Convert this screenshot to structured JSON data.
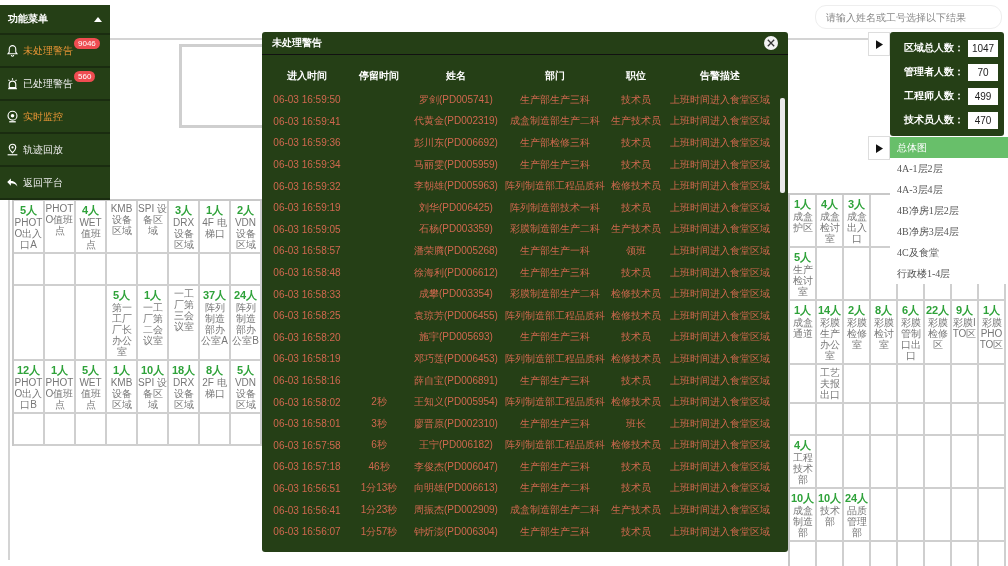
{
  "search": {
    "placeholder": "请输入姓名或工号选择以下结果"
  },
  "menu": {
    "title": "功能菜单",
    "expanded": true,
    "items": [
      {
        "label": "未处理警告",
        "highlighted": true,
        "badge": "9046"
      },
      {
        "label": "已处理警告",
        "highlighted": false,
        "badge": "560"
      },
      {
        "label": "实时监控",
        "highlighted": true
      },
      {
        "label": "轨迹回放",
        "highlighted": false
      },
      {
        "label": "返回平台",
        "highlighted": false
      }
    ]
  },
  "stats": [
    {
      "label": "区域总人数：",
      "value": "1047"
    },
    {
      "label": "管理者人数：",
      "value": "70"
    },
    {
      "label": "工程师人数：",
      "value": "499"
    },
    {
      "label": "技术员人数：",
      "value": "470"
    }
  ],
  "floors": [
    {
      "label": "总体图",
      "selected": true
    },
    {
      "label": "4A-1层2层",
      "selected": false
    },
    {
      "label": "4A-3层4层",
      "selected": false
    },
    {
      "label": "4B净房1层2层",
      "selected": false
    },
    {
      "label": "4B净房3层4层",
      "selected": false
    },
    {
      "label": "4C及食堂",
      "selected": false
    },
    {
      "label": "行政楼1-4层",
      "selected": false
    }
  ],
  "plan": {
    "left_rooms": [
      {
        "kind": "rooms",
        "cells": [
          {
            "kind": "room",
            "count": "5人",
            "label": "PHOTO出入口A"
          },
          {
            "kind": "room",
            "label": "PHOTO值班点"
          },
          {
            "kind": "room",
            "count": "4人",
            "label": "WET 值班点"
          },
          {
            "kind": "room",
            "label": "KMB 设备区域"
          },
          {
            "kind": "room",
            "label": "SPI 设备区域"
          },
          {
            "kind": "room",
            "count": "3人",
            "label": "DRX 设备区域"
          },
          {
            "kind": "room",
            "count": "1人",
            "label": "4F 电梯口"
          },
          {
            "kind": "room",
            "count": "2人",
            "label": "VDN 设备区域"
          }
        ]
      },
      {
        "kind": "blank"
      },
      {
        "kind": "rooms",
        "cells": [
          {
            "kind": "empty"
          },
          {
            "kind": "empty"
          },
          {
            "kind": "empty"
          },
          {
            "kind": "room",
            "count": "5人",
            "label": "第一工厂厂长办公室"
          },
          {
            "kind": "room",
            "count": "1人",
            "label": "一工厂第二会议室"
          },
          {
            "kind": "room",
            "label": "一工厂第三会议室"
          },
          {
            "kind": "room",
            "count": "37人",
            "label": "阵列制造部办公室A"
          },
          {
            "kind": "room",
            "count": "24人",
            "label": "阵列制造部办公室B"
          }
        ]
      },
      {
        "kind": "rooms",
        "cells": [
          {
            "kind": "room",
            "count": "12人",
            "label": "PHOTO出入口B"
          },
          {
            "kind": "room",
            "count": "1人",
            "label": "PHOTO值班点"
          },
          {
            "kind": "room",
            "count": "5人",
            "label": "WET 值班点"
          },
          {
            "kind": "room",
            "count": "1人",
            "label": "KMB 设备区域"
          },
          {
            "kind": "room",
            "count": "10人",
            "label": "SPI 设备区域"
          },
          {
            "kind": "room",
            "count": "18人",
            "label": "DRX 设备区域"
          },
          {
            "kind": "room",
            "count": "8人",
            "label": "2F 电梯口"
          },
          {
            "kind": "room",
            "count": "5人",
            "label": "VDN 设备区域"
          }
        ]
      },
      {
        "kind": "blank"
      }
    ],
    "right_rooms": [
      {
        "kind": "rooms",
        "cells": [
          {
            "kind": "room",
            "count": "1人",
            "label": "成盒护区"
          },
          {
            "kind": "room",
            "count": "4人",
            "label": "成盒检讨室"
          },
          {
            "kind": "room",
            "count": "3人",
            "label": "成盒出入口"
          }
        ]
      },
      {
        "kind": "rooms",
        "cells": [
          {
            "kind": "room",
            "count": "5人",
            "label": "生产检讨室"
          }
        ]
      },
      {
        "kind": "rooms",
        "cells": [
          {
            "kind": "room",
            "count": "1人",
            "label": "成盒通道"
          },
          {
            "kind": "room",
            "count": "14人",
            "label": "彩膜生产办公室"
          },
          {
            "kind": "room",
            "count": "2人",
            "label": "彩膜检修室"
          },
          {
            "kind": "room",
            "count": "8人",
            "label": "彩膜检讨室"
          },
          {
            "kind": "room",
            "count": "6人",
            "label": "彩膜管制口出口"
          },
          {
            "kind": "room",
            "count": "22人",
            "label": "彩膜检修区"
          },
          {
            "kind": "room",
            "count": "9人",
            "label": "彩膜ITO区"
          },
          {
            "kind": "room",
            "count": "1人",
            "label": "彩膜PHOTO区"
          }
        ]
      },
      {
        "kind": "rooms",
        "cells": [
          {
            "kind": "empty"
          },
          {
            "kind": "room",
            "label": "工艺夫报出口"
          }
        ]
      },
      {
        "kind": "blank"
      },
      {
        "kind": "rooms",
        "cells": [
          {
            "kind": "room",
            "count": "4人",
            "label": "工程技术部"
          }
        ]
      },
      {
        "kind": "rooms",
        "cells": [
          {
            "kind": "room",
            "count": "10人",
            "label": "成盒制造部"
          },
          {
            "kind": "room",
            "count": "10人",
            "label": "技术部"
          },
          {
            "kind": "room",
            "count": "24人",
            "label": "品质管理部"
          }
        ]
      },
      {
        "kind": "blank"
      }
    ]
  },
  "dialog": {
    "title": "未处理警告",
    "columns": [
      "进入时间",
      "停留时间",
      "姓名",
      "部门",
      "职位",
      "告警描述"
    ],
    "rows": [
      {
        "time": "06-03 16:59:50",
        "name": "罗剑(PD005741)",
        "department": "生产部生产三科",
        "position": "技术员",
        "description": "上班时间进入食堂区域"
      },
      {
        "time": "06-03 16:59:41",
        "name": "代黄金(PD002319)",
        "department": "成盒制造部生产二科",
        "position": "生产技术员",
        "description": "上班时间进入食堂区域"
      },
      {
        "time": "06-03 16:59:36",
        "name": "彭川东(PD006692)",
        "department": "生产部检修三科",
        "position": "技术员",
        "description": "上班时间进入食堂区域"
      },
      {
        "time": "06-03 16:59:34",
        "name": "马丽雯(PD005959)",
        "department": "生产部生产三科",
        "position": "技术员",
        "description": "上班时间进入食堂区域"
      },
      {
        "time": "06-03 16:59:32",
        "name": "李朝雄(PD005963)",
        "department": "阵列制造部工程品质科",
        "position": "检修技术员",
        "description": "上班时间进入食堂区域"
      },
      {
        "time": "06-03 16:59:19",
        "name": "刘华(PD006425)",
        "department": "阵列制造部技术一科",
        "position": "技术员",
        "description": "上班时间进入食堂区域"
      },
      {
        "time": "06-03 16:59:05",
        "name": "石杨(PD003359)",
        "department": "彩膜制造部生产二科",
        "position": "生产技术员",
        "description": "上班时间进入食堂区域"
      },
      {
        "time": "06-03 16:58:57",
        "name": "潘荣腾(PD005268)",
        "department": "生产部生产一科",
        "position": "领班",
        "description": "上班时间进入食堂区域"
      },
      {
        "time": "06-03 16:58:48",
        "name": "徐海利(PD006612)",
        "department": "生产部生产三科",
        "position": "技术员",
        "description": "上班时间进入食堂区域"
      },
      {
        "time": "06-03 16:58:33",
        "name": "成攀(PD003354)",
        "department": "彩膜制造部生产二科",
        "position": "检修技术员",
        "description": "上班时间进入食堂区域"
      },
      {
        "time": "06-03 16:58:25",
        "name": "袁琼芳(PD006455)",
        "department": "阵列制造部工程品质科",
        "position": "检修技术员",
        "description": "上班时间进入食堂区域"
      },
      {
        "time": "06-03 16:58:20",
        "name": "施宇(PD005693)",
        "department": "生产部生产三科",
        "position": "技术员",
        "description": "上班时间进入食堂区域"
      },
      {
        "time": "06-03 16:58:19",
        "name": "邓巧莲(PD006453)",
        "department": "阵列制造部工程品质科",
        "position": "检修技术员",
        "description": "上班时间进入食堂区域"
      },
      {
        "time": "06-03 16:58:16",
        "name": "薛自宝(PD006891)",
        "department": "生产部生产三科",
        "position": "技术员",
        "description": "上班时间进入食堂区域"
      },
      {
        "time": "06-03 16:58:02",
        "stay": "2秒",
        "name": "王知义(PD005954)",
        "department": "阵列制造部工程品质科",
        "position": "检修技术员",
        "description": "上班时间进入食堂区域"
      },
      {
        "time": "06-03 16:58:01",
        "stay": "3秒",
        "name": "廖晋原(PD002310)",
        "department": "生产部生产三科",
        "position": "班长",
        "description": "上班时间进入食堂区域"
      },
      {
        "time": "06-03 16:57:58",
        "stay": "6秒",
        "name": "王宁(PD006182)",
        "department": "阵列制造部工程品质科",
        "position": "检修技术员",
        "description": "上班时间进入食堂区域"
      },
      {
        "time": "06-03 16:57:18",
        "stay": "46秒",
        "name": "李俊杰(PD006047)",
        "department": "生产部生产三科",
        "position": "技术员",
        "description": "上班时间进入食堂区域"
      },
      {
        "time": "06-03 16:56:51",
        "stay": "1分13秒",
        "name": "向明雄(PD006613)",
        "department": "生产部生产二科",
        "position": "技术员",
        "description": "上班时间进入食堂区域"
      },
      {
        "time": "06-03 16:56:41",
        "stay": "1分23秒",
        "name": "周振杰(PD002909)",
        "department": "成盒制造部生产二科",
        "position": "生产技术员",
        "description": "上班时间进入食堂区域"
      },
      {
        "time": "06-03 16:56:07",
        "stay": "1分57秒",
        "name": "钟炘澎(PD006304)",
        "department": "生产部生产三科",
        "position": "技术员",
        "description": "上班时间进入食堂区域"
      }
    ]
  }
}
